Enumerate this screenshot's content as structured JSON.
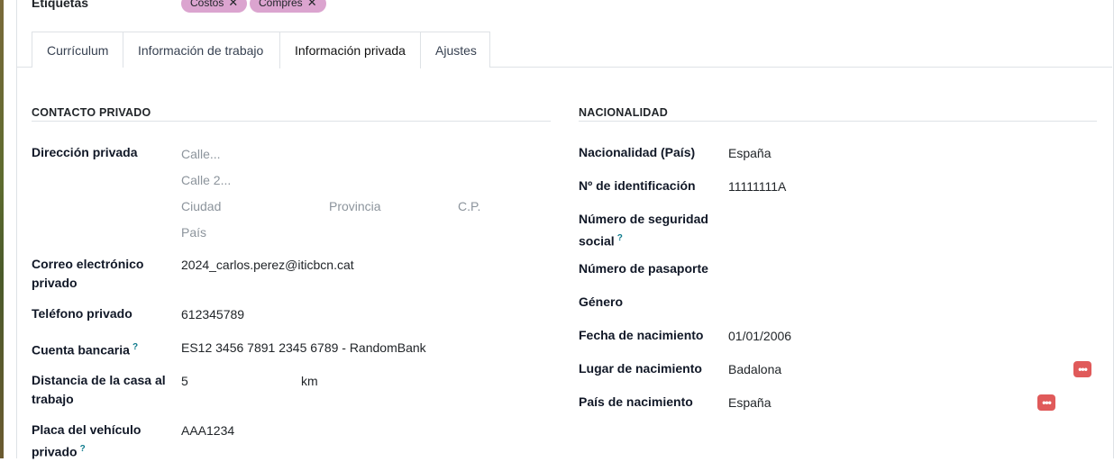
{
  "header": {
    "tags_label": "Etiquetas",
    "tags": [
      {
        "label": "Costos",
        "remove": "✕"
      },
      {
        "label": "Compres",
        "remove": "✕"
      }
    ],
    "tag_color": "#dba4cf"
  },
  "tabs": [
    {
      "label": "Currículum"
    },
    {
      "label": "Información de trabajo"
    },
    {
      "label": "Información privada",
      "active": true
    },
    {
      "label": "Ajustes"
    }
  ],
  "private_contact": {
    "title": "CONTACTO PRIVADO",
    "address_label": "Dirección privada",
    "street_placeholder": "Calle...",
    "street2_placeholder": "Calle 2...",
    "city_placeholder": "Ciudad",
    "state_placeholder": "Provincia",
    "zip_placeholder": "C.P.",
    "country_placeholder": "País",
    "email_label": "Correo electrónico privado",
    "email_value": "2024_carlos.perez@iticbcn.cat",
    "phone_label": "Teléfono privado",
    "phone_value": "612345789",
    "bank_label": "Cuenta bancaria",
    "bank_value": "ES12 3456 7891 2345 6789 - RandomBank",
    "distance_label": "Distancia de la casa al trabajo",
    "distance_value": "5",
    "distance_unit": "km",
    "plate_label": "Placa del vehículo privado",
    "plate_value": "AAA1234",
    "help_mark": "?"
  },
  "nationality": {
    "title": "NACIONALIDAD",
    "country_label": "Nacionalidad (País)",
    "country_value": "España",
    "id_label": "Nº de identificación",
    "id_value": "11111111A",
    "ssn_label": "Número de seguridad social",
    "passport_label": "Número de pasaporte",
    "gender_label": "Género",
    "birthdate_label": "Fecha de nacimiento",
    "birthdate_value": "01/01/2006",
    "birthplace_label": "Lugar de nacimiento",
    "birthplace_value": "Badalona",
    "birth_country_label": "País de nacimiento",
    "birth_country_value": "España",
    "more_icon": "•••",
    "accent_color": "#e05a5a"
  }
}
